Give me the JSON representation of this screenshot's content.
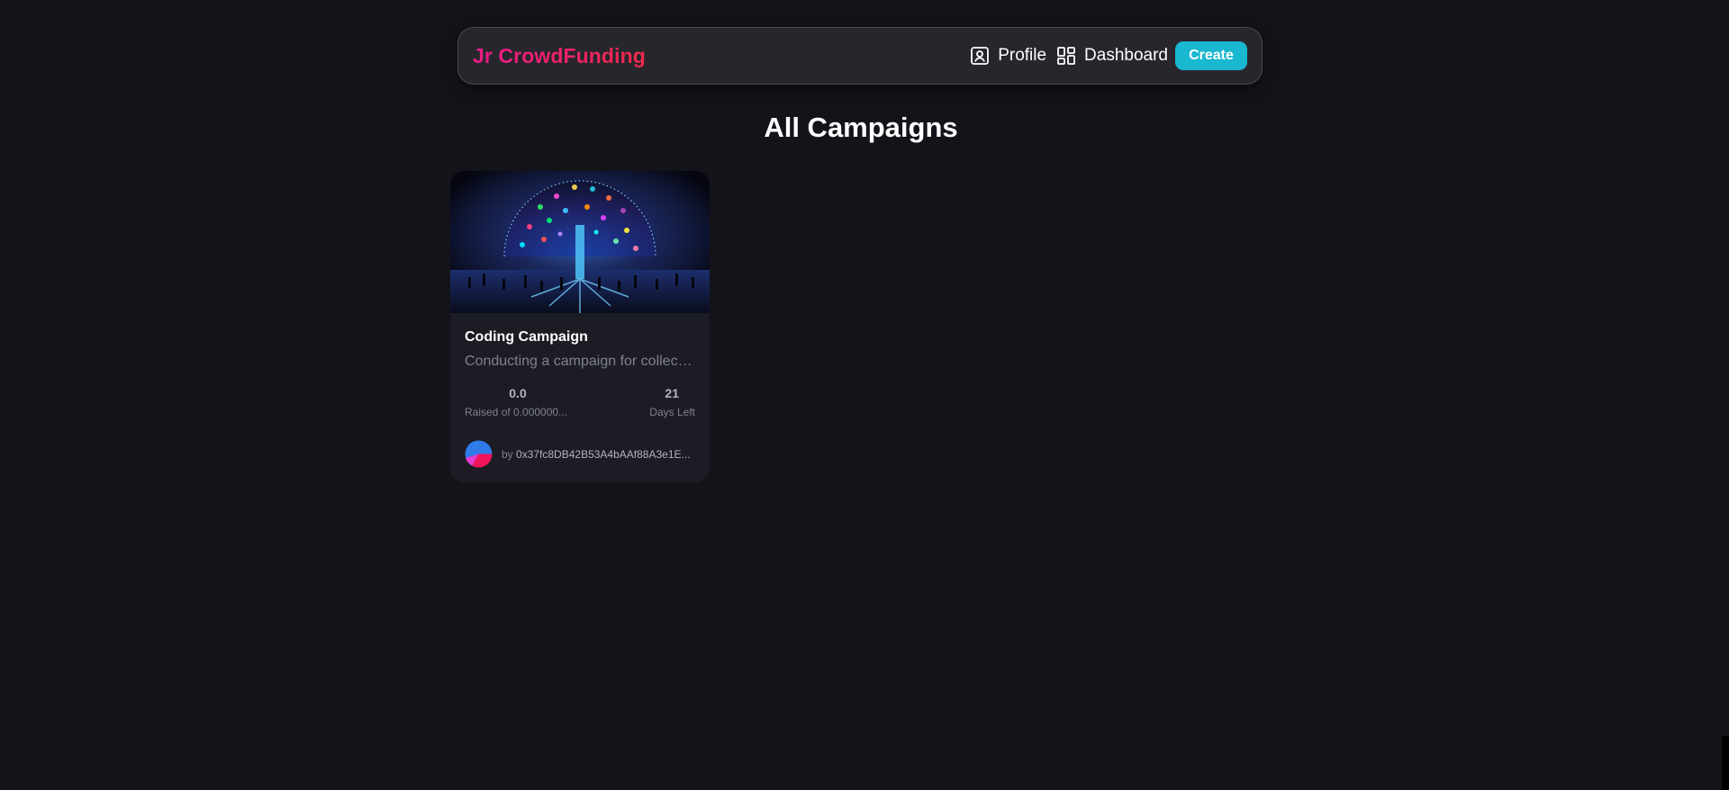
{
  "navbar": {
    "brand": "Jr CrowdFunding",
    "links": [
      {
        "label": "Profile",
        "icon": "user-square-icon"
      },
      {
        "label": "Dashboard",
        "icon": "dashboard-icon"
      }
    ],
    "create_label": "Create"
  },
  "page_title": "All Campaigns",
  "campaigns": [
    {
      "title": "Coding Campaign",
      "description": "Conducting a campaign for collecting funds",
      "raised": "0.0",
      "raised_label": "Raised of 0.000000...",
      "days_left": "21",
      "days_left_label": "Days Left",
      "owner_prefix": "by",
      "owner": "0x37fc8DB42B53A4bAAf88A3e1E..."
    }
  ],
  "colors": {
    "background": "#13131a",
    "card": "#1c1c24",
    "accent": "#19b7d0",
    "brand_gradient_start": "#ec1a8a",
    "brand_gradient_end": "#ef2a4a"
  }
}
